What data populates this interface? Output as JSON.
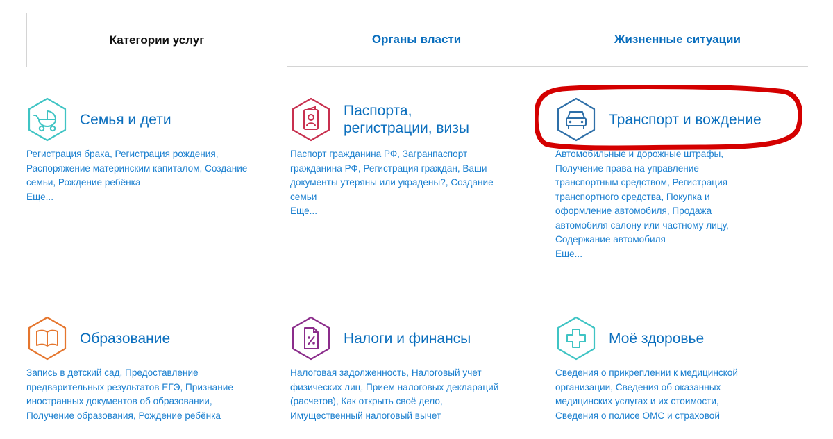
{
  "tabs": [
    {
      "label": "Категории услуг",
      "active": true
    },
    {
      "label": "Органы власти",
      "active": false
    },
    {
      "label": "Жизненные ситуации",
      "active": false
    }
  ],
  "colors": {
    "link": "#1a7fcf",
    "title": "#0a6ebd",
    "family": "#3fc4c4",
    "passport": "#c8304f",
    "transport": "#2e6fa8",
    "education": "#e5762e",
    "taxes": "#8b2d8b",
    "health": "#3fc4c4",
    "annotation": "#d40000"
  },
  "categories": [
    {
      "title": "Семья и дети",
      "icon": "baby-stroller-icon",
      "links": "Регистрация брака, Регистрация рождения, Распоряжение материнским капиталом, Создание семьи, Рождение ребёнка",
      "more": "Еще..."
    },
    {
      "title": "Паспорта,\nрегистрации, визы",
      "icon": "passport-icon",
      "links": "Паспорт гражданина РФ, Загранпаспорт гражданина РФ, Регистрация граждан, Ваши документы утеряны или украдены?, Создание семьи",
      "more": "Еще..."
    },
    {
      "title": "Транспорт и вождение",
      "icon": "car-icon",
      "links": "Автомобильные и дорожные штрафы, Получение права на управление транспортным средством, Регистрация транспортного средства, Покупка и оформление автомобиля, Продажа автомобиля салону или частному лицу, Содержание автомобиля",
      "more": "Еще..."
    },
    {
      "title": "Образование",
      "icon": "book-icon",
      "links": "Запись в детский сад, Предоставление предварительных результатов ЕГЭ, Признание иностранных документов об образовании, Получение образования, Рождение ребёнка",
      "more": ""
    },
    {
      "title": "Налоги и финансы",
      "icon": "tax-document-icon",
      "links": "Налоговая задолженность, Налоговый учет физических лиц, Прием налоговых деклараций (расчетов), Как открыть своё дело, Имущественный налоговый вычет",
      "more": ""
    },
    {
      "title": "Моё здоровье",
      "icon": "medical-cross-icon",
      "links": "Сведения о прикреплении к медицинской организации, Сведения об оказанных медицинских услугах и их стоимости, Сведения о полисе ОМС и страховой",
      "more": ""
    }
  ]
}
